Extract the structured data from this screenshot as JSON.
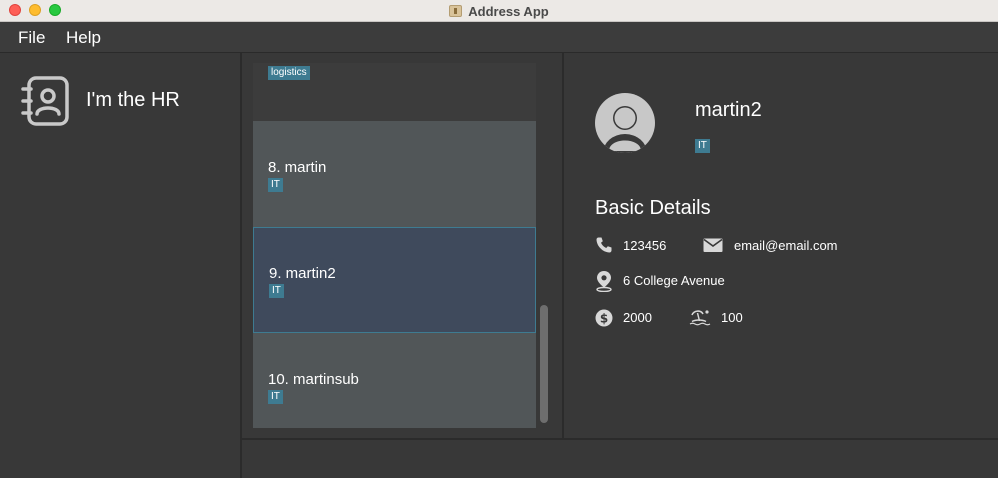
{
  "window": {
    "title": "Address App"
  },
  "menu": {
    "file": "File",
    "help": "Help"
  },
  "brand": {
    "title": "I'm the HR"
  },
  "list": {
    "partial_tag": "logistics",
    "items": [
      {
        "label": "8.  martin",
        "tag": "IT"
      },
      {
        "label": "9.  martin2",
        "tag": "IT"
      },
      {
        "label": "10.  martinsub",
        "tag": "IT"
      }
    ]
  },
  "detail": {
    "name": "martin2",
    "tag": "IT",
    "section_title": "Basic Details",
    "phone": "123456",
    "email": "email@email.com",
    "address": "6 College Avenue",
    "salary": "2000",
    "leave": "100"
  },
  "colors": {
    "background": "#383838",
    "card": "#515658",
    "selected_card": "#3f4a5c",
    "tag": "#3e7b91"
  },
  "icons": {
    "brand": "contact-book-icon",
    "avatar": "user-avatar-icon",
    "phone": "phone-icon",
    "email": "envelope-icon",
    "address": "location-pin-icon",
    "salary": "dollar-icon",
    "leave": "beach-icon"
  }
}
